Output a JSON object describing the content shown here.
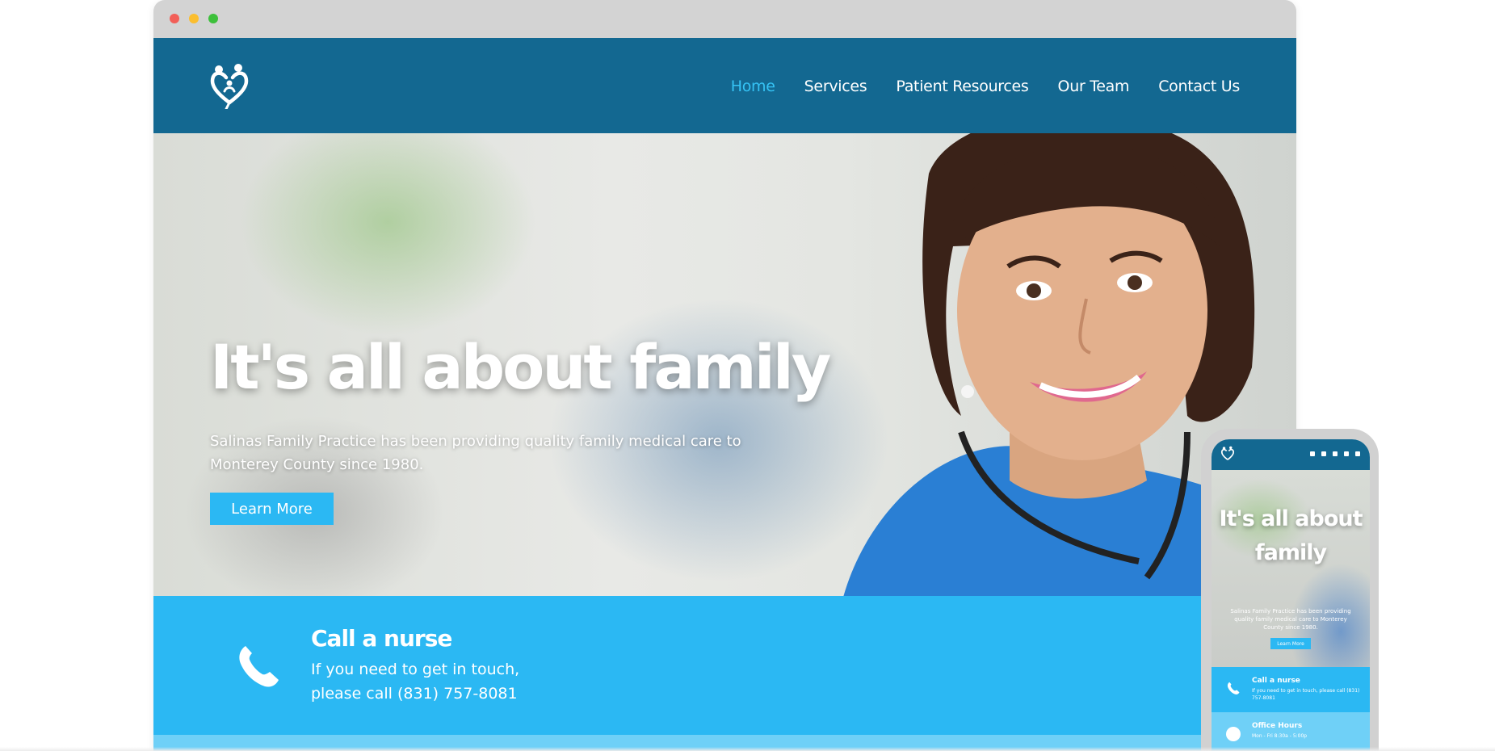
{
  "nav": {
    "items": [
      {
        "label": "Home",
        "active": true
      },
      {
        "label": "Services",
        "active": false
      },
      {
        "label": "Patient Resources",
        "active": false
      },
      {
        "label": "Our Team",
        "active": false
      },
      {
        "label": "Contact Us",
        "active": false
      }
    ]
  },
  "hero": {
    "title": "It's all about family",
    "subtitle": "Salinas Family Practice has been providing quality family medical care to Monterey County since 1980.",
    "button_label": "Learn More"
  },
  "call": {
    "title": "Call a nurse",
    "text": "If you need to get in touch, please call (831) 757-8081"
  },
  "mobile": {
    "hero_title": "It's all about family",
    "hero_subtitle": "Salinas Family Practice has been providing quality family medical care to Monterey County since 1980.",
    "button_label": "Learn More",
    "call_title": "Call a nurse",
    "call_text": "If you need to get in touch, please call (831) 757-8081",
    "hours_title": "Office Hours",
    "hours_text": "Mon - Fri 8:30a - 5:00p"
  },
  "colors": {
    "header": "#136891",
    "accent": "#2bb8f3",
    "active_nav": "#35c3f5",
    "band_secondary": "#6fd0f7"
  },
  "icons": {
    "logo": "family-heart-logo-icon",
    "call": "phone-icon",
    "hours": "clock-icon"
  }
}
